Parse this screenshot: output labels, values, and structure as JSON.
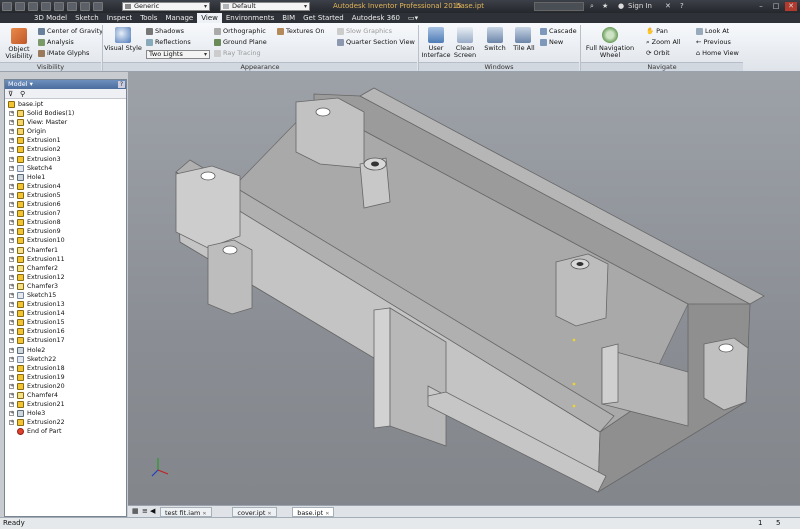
{
  "titlebar": {
    "style_combo": "Generic",
    "appearance_combo": "Default",
    "app_title": "Autodesk Inventor Professional 2015",
    "doc_title": "base.ipt",
    "sign_in": "Sign In"
  },
  "tabs": [
    "3D Model",
    "Sketch",
    "Inspect",
    "Tools",
    "Manage",
    "View",
    "Environments",
    "BIM",
    "Get Started",
    "Autodesk 360"
  ],
  "active_tab": "View",
  "ribbon": {
    "visibility": {
      "panel_label": "Visibility",
      "object_visibility": "Object Visibility",
      "center_of_gravity": "Center of Gravity",
      "analysis": "Analysis",
      "imate_glyphs": "iMate Glyphs"
    },
    "appearance": {
      "panel_label": "Appearance",
      "visual_style": "Visual Style",
      "shadows": "Shadows",
      "reflections": "Reflections",
      "lighting": "Two Lights",
      "orthographic": "Orthographic",
      "ground_plane": "Ground Plane",
      "ray_tracing": "Ray Tracing",
      "textures_on": "Textures On",
      "slow_graphics": "Slow Graphics",
      "quarter_section_view": "Quarter Section View"
    },
    "windows": {
      "panel_label": "Windows",
      "user_interface": "User Interface",
      "clean_screen": "Clean Screen",
      "switch": "Switch",
      "tile_all": "Tile All",
      "cascade": "Cascade",
      "new": "New"
    },
    "navigate": {
      "panel_label": "Navigate",
      "full_navigation_wheel": "Full Navigation Wheel",
      "pan": "Pan",
      "zoom_all": "Zoom All",
      "orbit": "Orbit",
      "look_at": "Look At",
      "previous": "Previous",
      "home_view": "Home View"
    }
  },
  "browser": {
    "title": "Model",
    "root": "base.ipt",
    "items": [
      "Solid Bodies(1)",
      "View: Master",
      "Origin",
      "Extrusion1",
      "Extrusion2",
      "Extrusion3",
      "Sketch4",
      "Hole1",
      "Extrusion4",
      "Extrusion5",
      "Extrusion6",
      "Extrusion7",
      "Extrusion8",
      "Extrusion9",
      "Extrusion10",
      "Chamfer1",
      "Extrusion11",
      "Chamfer2",
      "Extrusion12",
      "Chamfer3",
      "Sketch15",
      "Extrusion13",
      "Extrusion14",
      "Extrusion15",
      "Extrusion16",
      "Extrusion17",
      "Hole2",
      "Sketch22",
      "Extrusion18",
      "Extrusion19",
      "Extrusion20",
      "Chamfer4",
      "Extrusion21",
      "Hole3",
      "Extrusion22",
      "End of Part"
    ]
  },
  "document_tabs": [
    "test fit.iam",
    "cover.ipt",
    "base.ipt"
  ],
  "active_document": "base.ipt",
  "status": {
    "text": "Ready",
    "count_a": "1",
    "count_b": "5"
  },
  "colors": {
    "accent_title": "#e2b45a",
    "viewport_bg": "#8a8e94",
    "model_face": "#b9b9b9",
    "feature_icon": "#f3c431"
  },
  "icons": {
    "expand": "plus-box-icon",
    "feature": "extrusion-icon",
    "viewcube": "viewcube-icon",
    "navbar": "navigation-bar-icon",
    "axis_triad": "xyz-triad-icon"
  }
}
